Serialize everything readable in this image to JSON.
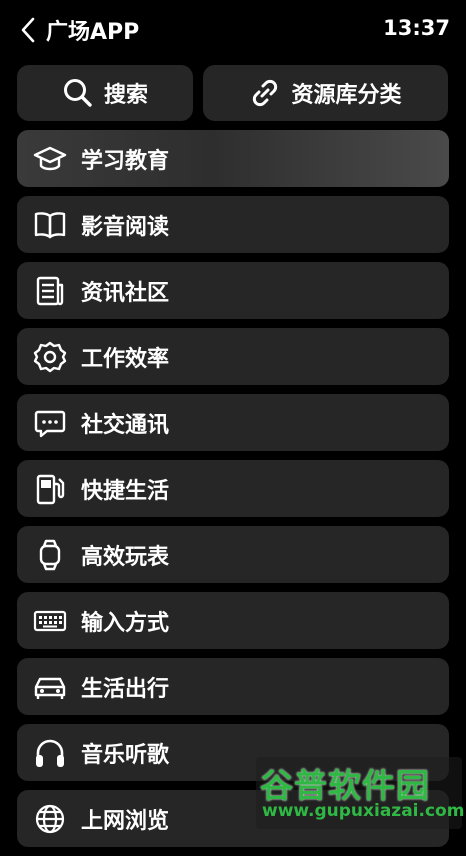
{
  "status_bar": {
    "title": "广场APP",
    "time": "13:37"
  },
  "top_buttons": {
    "search_label": "搜索",
    "category_label": "资源库分类"
  },
  "categories": [
    {
      "label": "学习教育",
      "icon": "graduation-cap-icon",
      "active": true
    },
    {
      "label": "影音阅读",
      "icon": "book-icon"
    },
    {
      "label": "资讯社区",
      "icon": "news-icon"
    },
    {
      "label": "工作效率",
      "icon": "gear-icon"
    },
    {
      "label": "社交通讯",
      "icon": "chat-bubble-icon"
    },
    {
      "label": "快捷生活",
      "icon": "fuel-pump-icon"
    },
    {
      "label": "高效玩表",
      "icon": "watch-icon"
    },
    {
      "label": "输入方式",
      "icon": "keyboard-icon"
    },
    {
      "label": "生活出行",
      "icon": "car-icon"
    },
    {
      "label": "音乐听歌",
      "icon": "headphones-icon"
    },
    {
      "label": "上网浏览",
      "icon": "globe-icon"
    }
  ],
  "watermark": {
    "title": "谷普软件园",
    "url": "www.gupuxiazai.com"
  },
  "colors": {
    "background": "#000000",
    "card": "#262626",
    "watermark_green": "#2fb844"
  }
}
